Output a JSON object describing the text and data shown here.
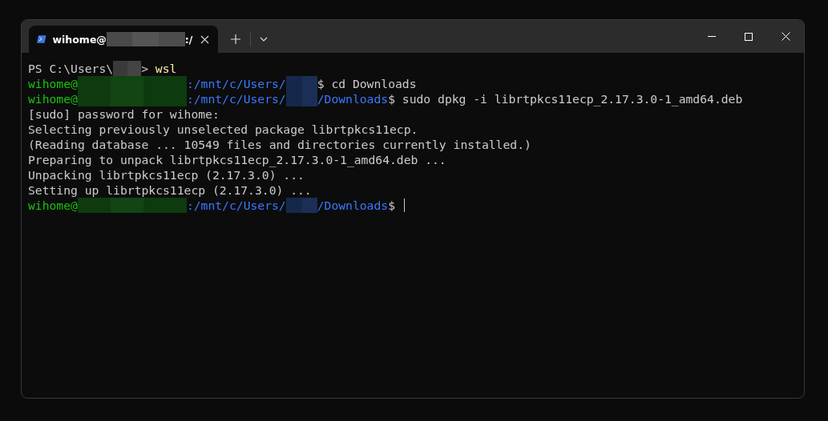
{
  "tab": {
    "title": [
      {
        "kind": "plain",
        "text": "wihome@"
      },
      {
        "kind": "redact_tab"
      },
      {
        "kind": "plain",
        "text": ":/"
      }
    ],
    "selected": true
  },
  "lines": [
    [
      {
        "kind": "plain",
        "text": "PS C:\\Users\\"
      },
      {
        "kind": "redact_short"
      },
      {
        "kind": "plain",
        "text": "> "
      },
      {
        "kind": "command",
        "text": "wsl"
      }
    ],
    [
      {
        "kind": "user",
        "text": "wihome@"
      },
      {
        "kind": "redact_host"
      },
      {
        "kind": "path",
        "text": ":/mnt/c/Users/"
      },
      {
        "kind": "redact_name"
      },
      {
        "kind": "plain",
        "text": "$ cd Downloads"
      }
    ],
    [
      {
        "kind": "user",
        "text": "wihome@"
      },
      {
        "kind": "redact_host"
      },
      {
        "kind": "path",
        "text": ":/mnt/c/Users/"
      },
      {
        "kind": "redact_name"
      },
      {
        "kind": "path",
        "text": "/Downloads"
      },
      {
        "kind": "plain",
        "text": "$ sudo dpkg -i librtpkcs11ecp_2.17.3.0-1_amd64.deb"
      }
    ],
    [
      {
        "kind": "plain",
        "text": "[sudo] password for wihome:"
      }
    ],
    [
      {
        "kind": "plain",
        "text": "Selecting previously unselected package librtpkcs11ecp."
      }
    ],
    [
      {
        "kind": "plain",
        "text": "(Reading database ... 10549 files and directories currently installed.)"
      }
    ],
    [
      {
        "kind": "plain",
        "text": "Preparing to unpack librtpkcs11ecp_2.17.3.0-1_amd64.deb ..."
      }
    ],
    [
      {
        "kind": "plain",
        "text": "Unpacking librtpkcs11ecp (2.17.3.0) ..."
      }
    ],
    [
      {
        "kind": "plain",
        "text": "Setting up librtpkcs11ecp (2.17.3.0) ..."
      }
    ],
    [
      {
        "kind": "user",
        "text": "wihome@"
      },
      {
        "kind": "redact_host"
      },
      {
        "kind": "path",
        "text": ":/mnt/c/Users/"
      },
      {
        "kind": "redact_name"
      },
      {
        "kind": "path",
        "text": "/Downloads"
      },
      {
        "kind": "plain",
        "text": "$ "
      },
      {
        "kind": "cursor"
      }
    ]
  ]
}
